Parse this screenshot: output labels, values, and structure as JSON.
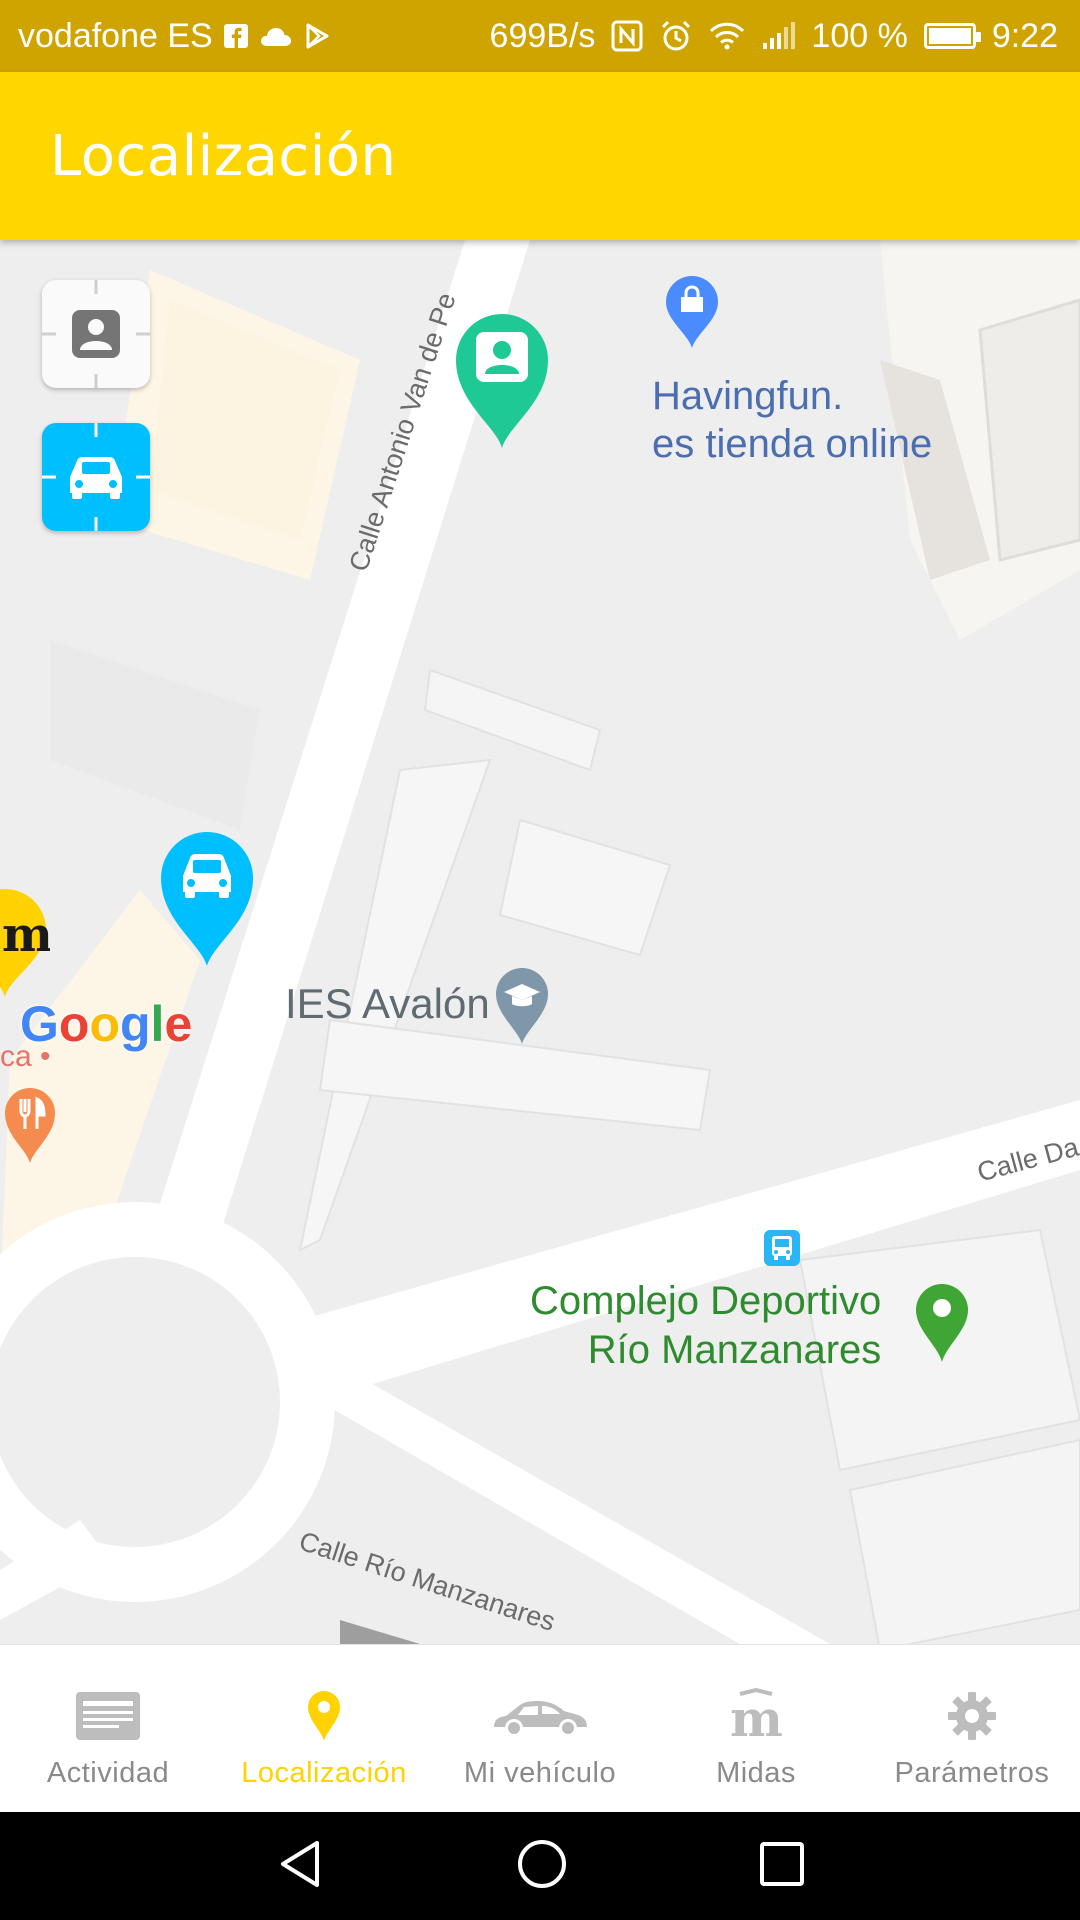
{
  "status_bar": {
    "carrier": "vodafone ES",
    "net_speed": "699B/s",
    "battery": "100 %",
    "time": "9:22"
  },
  "app_bar": {
    "title": "Localización"
  },
  "map": {
    "places": {
      "havingfun_line1": "Havingfun.",
      "havingfun_line2": "es tienda online",
      "ies": "IES Avalón",
      "complejo_line1": "Complejo Deportivo",
      "complejo_line2": "Río Manzanares"
    },
    "streets": {
      "antonio": "Calle Antonio Van de Pe",
      "rio": "Calle Río Manzanares",
      "da": "Calle Da"
    },
    "partial_labels": {
      "ca": "ca •"
    },
    "attribution": "Google"
  },
  "bottom_nav": {
    "items": [
      {
        "label": "Actividad",
        "icon": "activity-card-icon"
      },
      {
        "label": "Localización",
        "icon": "location-pin-icon"
      },
      {
        "label": "Mi vehículo",
        "icon": "car-icon"
      },
      {
        "label": "Midas",
        "icon": "midas-logo-icon"
      },
      {
        "label": "Parámetros",
        "icon": "gear-icon"
      }
    ],
    "active_index": 1
  },
  "colors": {
    "status_bar": "#cfa400",
    "app_bar": "#ffd600",
    "accent_active": "#ffd200",
    "car_blue": "#00bfff",
    "person_green": "#1ec995"
  }
}
